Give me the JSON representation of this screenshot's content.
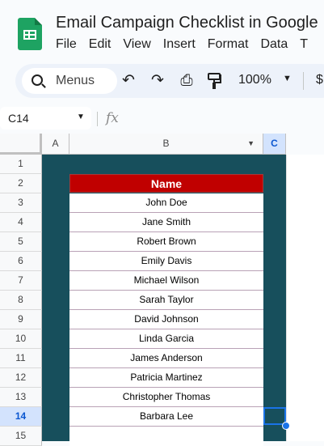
{
  "header": {
    "doc_title": "Email Campaign Checklist in Google",
    "menu": [
      "File",
      "Edit",
      "View",
      "Insert",
      "Format",
      "Data",
      "T"
    ]
  },
  "toolbar": {
    "search_label": "Menus",
    "undo_icon": "↶",
    "redo_icon": "↷",
    "print_icon": "⎙",
    "paint_format_icon": "paint-roller",
    "zoom": "100%",
    "currency_partial": "$"
  },
  "formula_bar": {
    "cell_ref": "C14",
    "fx_label": "fx"
  },
  "grid": {
    "columns": [
      "A",
      "B",
      "C"
    ],
    "rows": [
      "1",
      "2",
      "3",
      "4",
      "5",
      "6",
      "7",
      "8",
      "9",
      "10",
      "11",
      "12",
      "13",
      "14",
      "15"
    ],
    "active_row": "14",
    "active_column": "C",
    "table_header": "Name",
    "names": [
      "John Doe",
      "Jane Smith",
      "Robert Brown",
      "Emily Davis",
      "Michael Wilson",
      "Sarah Taylor",
      "David Johnson",
      "Linda Garcia",
      "James Anderson",
      "Patricia Martinez",
      "Christopher Thomas",
      "Barbara Lee"
    ]
  },
  "colors": {
    "background_fill": "#174f5c",
    "header_fill": "#c00000",
    "selection": "#1a73e8"
  }
}
